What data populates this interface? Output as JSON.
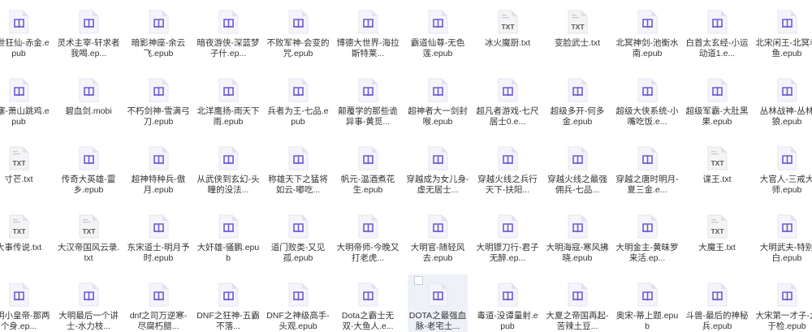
{
  "icon_colors": {
    "book_bg": "#f5f4fb",
    "book_fold": "#e3e0f2",
    "book_mark": "#6d5bd0",
    "txt_bg": "#f4f4f6",
    "txt_fold": "#e1e1e6",
    "txt_text": "#555555"
  },
  "files": [
    {
      "name": "傲世狂仙-赤金.epub",
      "type": "book"
    },
    {
      "name": "灵术主宰-轩求者我喝.ep...",
      "type": "book"
    },
    {
      "name": "暗影神座-余云飞.epub",
      "type": "book"
    },
    {
      "name": "暗夜游侠-深蓝梦子什.ep...",
      "type": "book"
    },
    {
      "name": "不败军神-会变的咒.epub",
      "type": "book"
    },
    {
      "name": "博德大世界-海拉斯特莱...",
      "type": "book"
    },
    {
      "name": "霸道仙尊-无色莲.epub",
      "type": "book"
    },
    {
      "name": "冰火魔厨.txt",
      "type": "txt"
    },
    {
      "name": "变脸武士.txt",
      "type": "txt"
    },
    {
      "name": "北冥神剑-池衡水南.epub",
      "type": "book"
    },
    {
      "name": "白首太玄经-小运动道1.e...",
      "type": "book"
    },
    {
      "name": "北宋闲王-北冥老鱼.epub",
      "type": "book"
    },
    {
      "name": "边塞-萧山跳鸡.epub",
      "type": "book"
    },
    {
      "name": "碧血剑.mobi",
      "type": "book"
    },
    {
      "name": "不朽剑神-雪满弓刀.epub",
      "type": "book"
    },
    {
      "name": "北洋鹰扬-雨天下雨.epub",
      "type": "book"
    },
    {
      "name": "兵者为王-七品.epub",
      "type": "book"
    },
    {
      "name": "颠覆学的那些诡异事-黄觅...",
      "type": "book"
    },
    {
      "name": "超神者大一剑封喉.epub",
      "type": "book"
    },
    {
      "name": "超凡者游戏-七尺居士0.e...",
      "type": "book"
    },
    {
      "name": "超级多开-何多金.epub",
      "type": "book"
    },
    {
      "name": "超级大侠系统-小嘴吃饭.e...",
      "type": "book"
    },
    {
      "name": "超级军霸-大肚黑果.epub",
      "type": "book"
    },
    {
      "name": "丛林战神-丛林狼.epub",
      "type": "book"
    },
    {
      "name": "寸芒.txt",
      "type": "txt"
    },
    {
      "name": "传奇大英雄-靈乡.epub",
      "type": "book"
    },
    {
      "name": "超神特种兵-傲月.epub",
      "type": "book"
    },
    {
      "name": "从武侠到玄幻-头瞳的没法...",
      "type": "book"
    },
    {
      "name": "称雄天下之猛将如云-嘟吃...",
      "type": "book"
    },
    {
      "name": "帆元-温酒煮花生.epub",
      "type": "book"
    },
    {
      "name": "穿越成为女儿身-虚无居士...",
      "type": "book"
    },
    {
      "name": "穿越火线之兵行天下-扶阳...",
      "type": "book"
    },
    {
      "name": "穿越火线之最强佣兵-七品...",
      "type": "book"
    },
    {
      "name": "穿越之唐时明月-夏三金.e...",
      "type": "book"
    },
    {
      "name": "谍王.txt",
      "type": "txt"
    },
    {
      "name": "大官人-三戒大师.epub",
      "type": "book"
    },
    {
      "name": "大事传说.txt",
      "type": "txt"
    },
    {
      "name": "大汉帝国风云录.txt",
      "type": "txt"
    },
    {
      "name": "东宋道士-明月予时.epub",
      "type": "book"
    },
    {
      "name": "大奸雄-骚鹏.epub",
      "type": "book"
    },
    {
      "name": "道门败类-又见孤.epub",
      "type": "book"
    },
    {
      "name": "大明帝师-今晚又打老虎...",
      "type": "book"
    },
    {
      "name": "大明官-随轻风去.epub",
      "type": "book"
    },
    {
      "name": "大明镖刀行-君子无醉.ep...",
      "type": "book"
    },
    {
      "name": "大明海寇-寒风拂晓.epub",
      "type": "book"
    },
    {
      "name": "大明金主-黄昧罗来活.ep...",
      "type": "book"
    },
    {
      "name": "大魔王.txt",
      "type": "txt"
    },
    {
      "name": "大明武夫-特别白.epub",
      "type": "book"
    },
    {
      "name": "大明小皇帝-那两个身.ep...",
      "type": "book"
    },
    {
      "name": "大明最后一个讲士-水力枝...",
      "type": "book"
    },
    {
      "name": "dnf之司万逆寒-尽腐朽腊...",
      "type": "book"
    },
    {
      "name": "DNF之狂神-五霸不落...",
      "type": "book"
    },
    {
      "name": "DNF之神级高手-头观.epub",
      "type": "book"
    },
    {
      "name": "Dota之霸士无双-大鱼人.e...",
      "type": "book"
    },
    {
      "name": "DOTA之最强血脉-老宅土...",
      "type": "book",
      "selected": true
    },
    {
      "name": "毒道-没谭量射.epub",
      "type": "book"
    },
    {
      "name": "大夏之帝国再起-苦辣土豆...",
      "type": "book"
    },
    {
      "name": "奥宋-蒂上题.epub",
      "type": "book"
    },
    {
      "name": "斗兽-最后的神秘兵.epub",
      "type": "book"
    },
    {
      "name": "大宋第一才子-九于检.epub",
      "type": "book"
    }
  ]
}
